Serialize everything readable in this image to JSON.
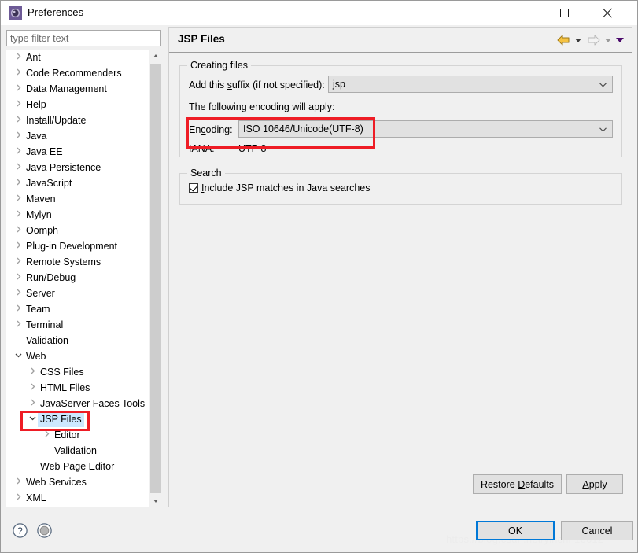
{
  "window": {
    "title": "Preferences",
    "icon": "preferences-gear-icon",
    "controls": {
      "minimize": "minimize-icon",
      "maximize": "maximize-icon",
      "close": "close-icon"
    }
  },
  "filter": {
    "placeholder": "type filter text",
    "value": ""
  },
  "tree": {
    "items": [
      {
        "label": "Ant",
        "level": 0,
        "expander": "collapsed"
      },
      {
        "label": "Code Recommenders",
        "level": 0,
        "expander": "collapsed"
      },
      {
        "label": "Data Management",
        "level": 0,
        "expander": "collapsed"
      },
      {
        "label": "Help",
        "level": 0,
        "expander": "collapsed"
      },
      {
        "label": "Install/Update",
        "level": 0,
        "expander": "collapsed"
      },
      {
        "label": "Java",
        "level": 0,
        "expander": "collapsed"
      },
      {
        "label": "Java EE",
        "level": 0,
        "expander": "collapsed"
      },
      {
        "label": "Java Persistence",
        "level": 0,
        "expander": "collapsed"
      },
      {
        "label": "JavaScript",
        "level": 0,
        "expander": "collapsed"
      },
      {
        "label": "Maven",
        "level": 0,
        "expander": "collapsed"
      },
      {
        "label": "Mylyn",
        "level": 0,
        "expander": "collapsed"
      },
      {
        "label": "Oomph",
        "level": 0,
        "expander": "collapsed"
      },
      {
        "label": "Plug-in Development",
        "level": 0,
        "expander": "collapsed"
      },
      {
        "label": "Remote Systems",
        "level": 0,
        "expander": "collapsed"
      },
      {
        "label": "Run/Debug",
        "level": 0,
        "expander": "collapsed"
      },
      {
        "label": "Server",
        "level": 0,
        "expander": "collapsed"
      },
      {
        "label": "Team",
        "level": 0,
        "expander": "collapsed"
      },
      {
        "label": "Terminal",
        "level": 0,
        "expander": "collapsed"
      },
      {
        "label": "Validation",
        "level": 0,
        "expander": "none"
      },
      {
        "label": "Web",
        "level": 0,
        "expander": "expanded"
      },
      {
        "label": "CSS Files",
        "level": 1,
        "expander": "collapsed"
      },
      {
        "label": "HTML Files",
        "level": 1,
        "expander": "collapsed"
      },
      {
        "label": "JavaServer Faces Tools",
        "level": 1,
        "expander": "collapsed"
      },
      {
        "label": "JSP Files",
        "level": 1,
        "expander": "expanded",
        "selected": true,
        "highlighted": true
      },
      {
        "label": "Editor",
        "level": 2,
        "expander": "collapsed"
      },
      {
        "label": "Validation",
        "level": 2,
        "expander": "none"
      },
      {
        "label": "Web Page Editor",
        "level": 1,
        "expander": "none"
      },
      {
        "label": "Web Services",
        "level": 0,
        "expander": "collapsed"
      },
      {
        "label": "XML",
        "level": 0,
        "expander": "collapsed"
      }
    ],
    "scrollbar": {
      "up": "scroll-up-icon",
      "down": "scroll-down-icon"
    }
  },
  "panel": {
    "title": "JSP Files",
    "nav": {
      "back": "back-arrow-icon",
      "back_menu": "back-dropdown-icon",
      "forward": "forward-arrow-icon",
      "forward_menu": "forward-dropdown-icon",
      "view_menu": "view-menu-icon"
    },
    "creating_files": {
      "group_title": "Creating files",
      "suffix_label_pre": "Add this ",
      "suffix_label_mnemonic": "s",
      "suffix_label_post": "uffix (if not specified):",
      "suffix_value": "jsp",
      "encoding_note": "The following encoding will apply:",
      "encoding_label_pre": "En",
      "encoding_label_mnemonic": "c",
      "encoding_label_post": "oding:",
      "encoding_value": "ISO 10646/Unicode(UTF-8)",
      "iana_label": "IANA:",
      "iana_value": "UTF-8"
    },
    "search": {
      "group_title": "Search",
      "checkbox_mnemonic": "I",
      "checkbox_label": "nclude JSP matches in Java searches",
      "checked": true
    },
    "buttons": {
      "restore_pre": "Restore ",
      "restore_mnemonic": "D",
      "restore_post": "efaults",
      "apply_mnemonic": "A",
      "apply_post": "pply"
    }
  },
  "footer": {
    "help_icon": "help-icon",
    "status_icon": "status-circle-icon",
    "ok": "OK",
    "cancel": "Cancel",
    "watermark": "https://blog.csdn.net/yinchn10612"
  },
  "colors": {
    "accent": "#0078d7",
    "annotation": "#ee1c25",
    "selection": "#cde8ff",
    "panel_bg": "#f0f0f0",
    "control_bg": "#e1e1e1"
  }
}
